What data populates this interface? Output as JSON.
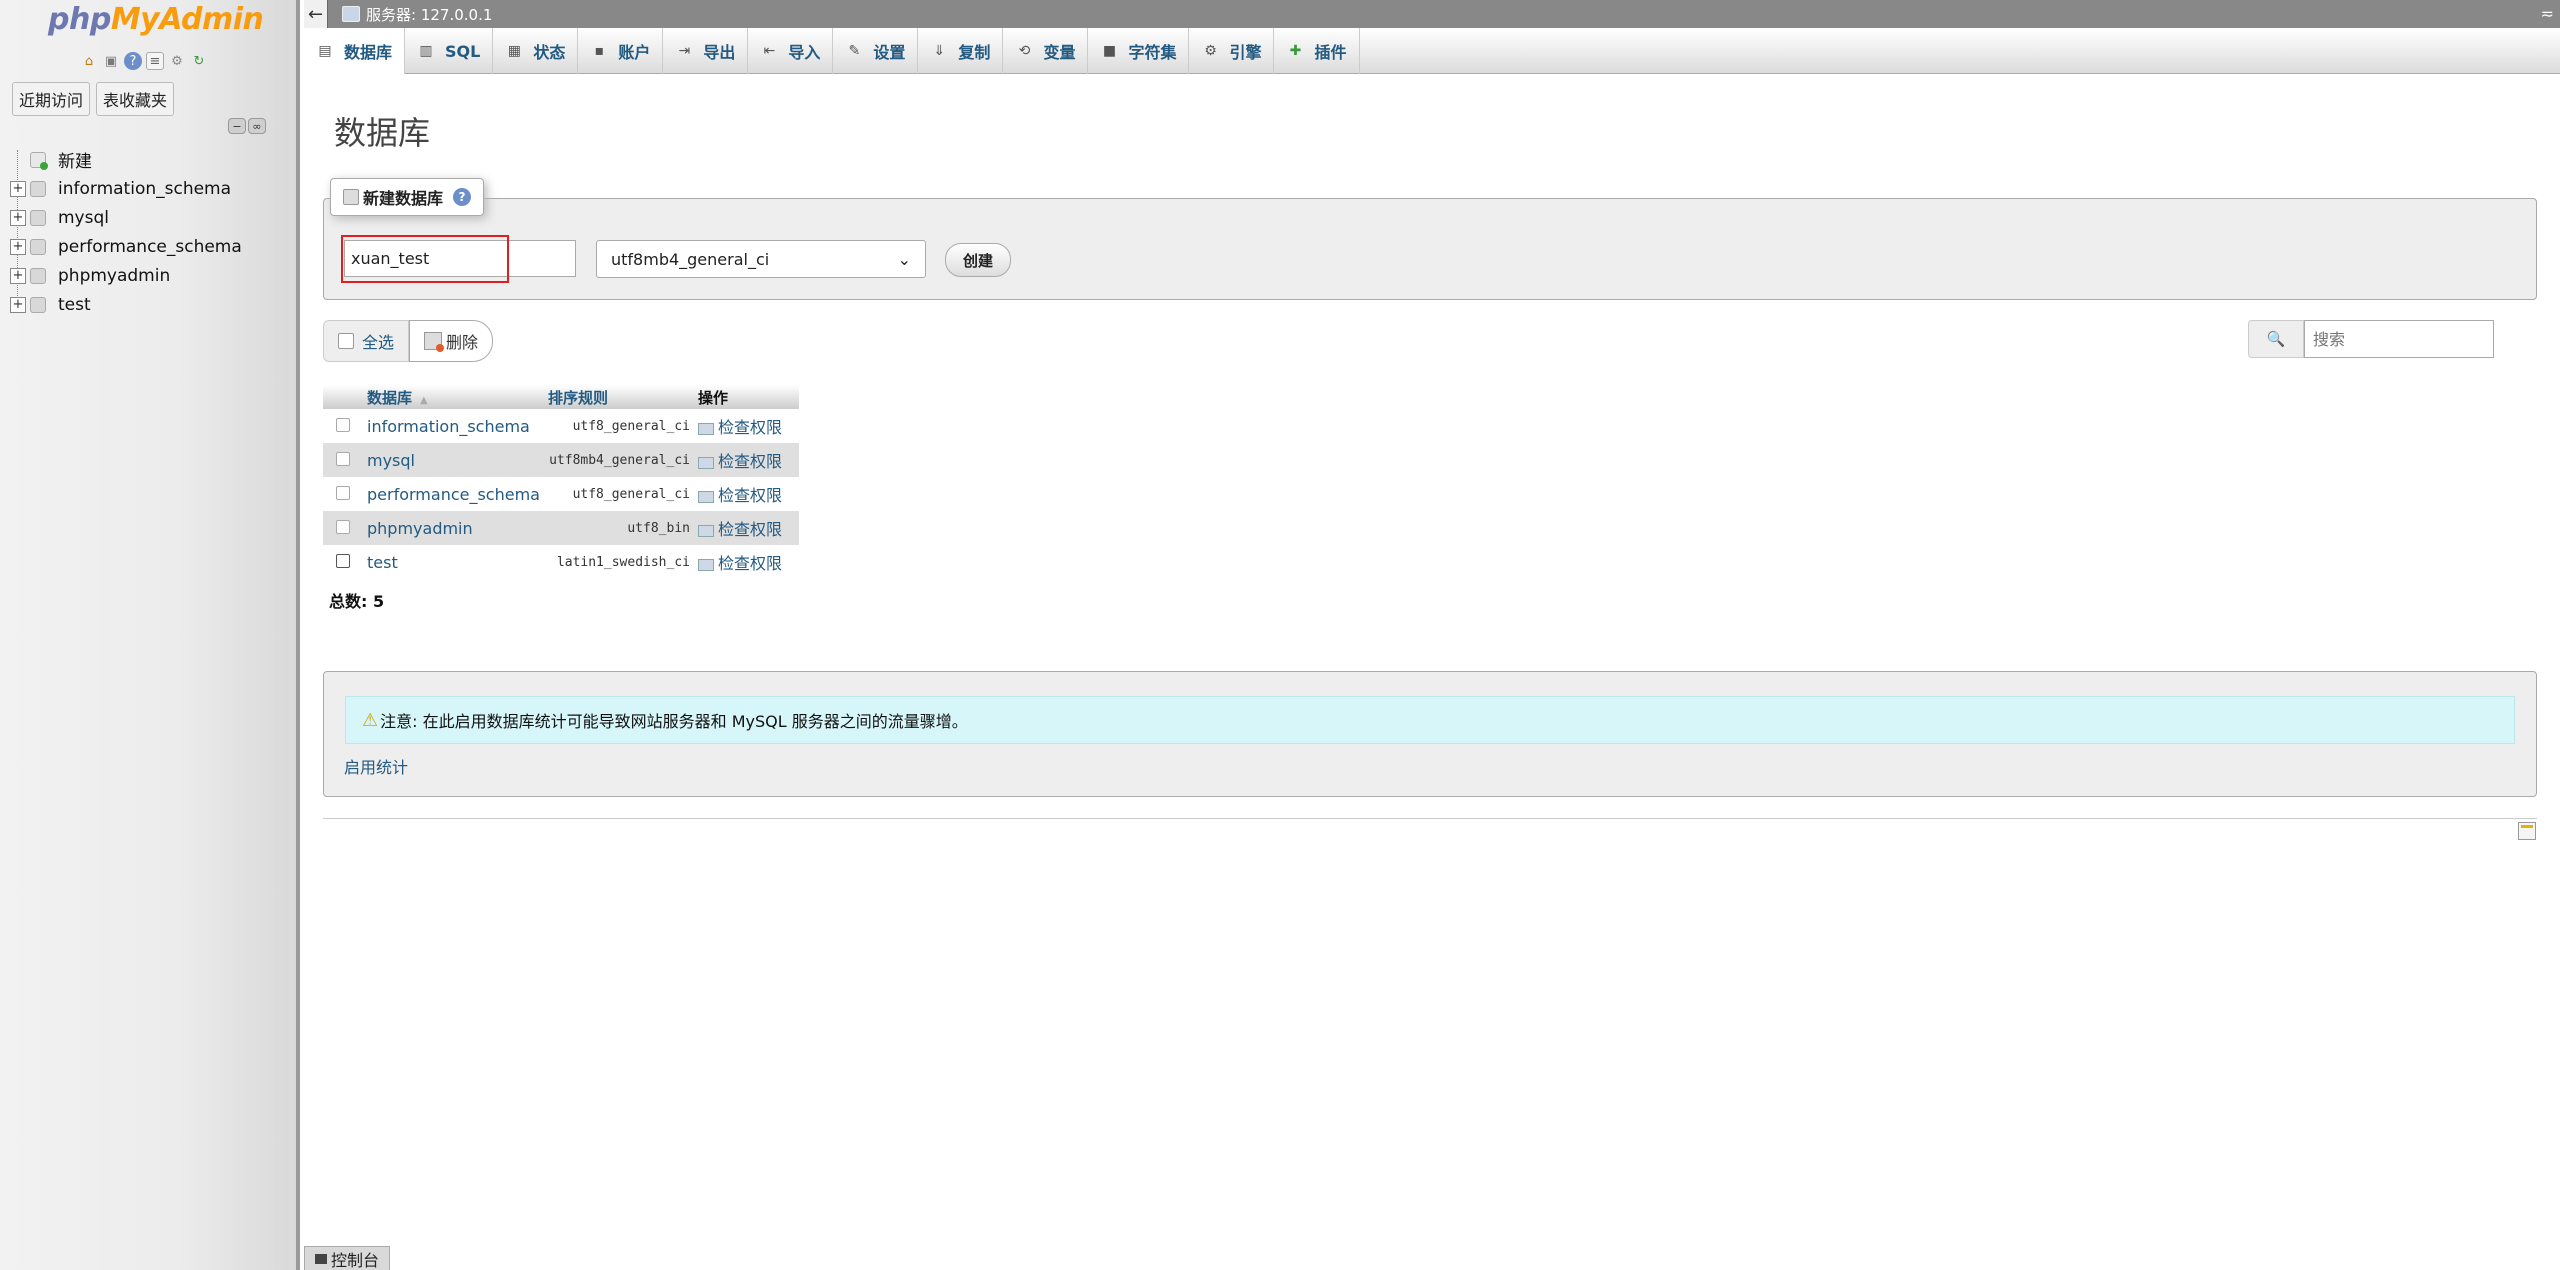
{
  "sidebar": {
    "logo": {
      "php": "php",
      "my": "My",
      "admin": "Admin"
    },
    "tabs": [
      "近期访问",
      "表收藏夹"
    ],
    "tree": [
      {
        "label": "新建",
        "expandable": false,
        "new": true
      },
      {
        "label": "information_schema",
        "expandable": true
      },
      {
        "label": "mysql",
        "expandable": true
      },
      {
        "label": "performance_schema",
        "expandable": true
      },
      {
        "label": "phpmyadmin",
        "expandable": true
      },
      {
        "label": "test",
        "expandable": true
      }
    ]
  },
  "topbar": {
    "back_glyph": "←",
    "server": "服务器:  127.0.0.1",
    "collapse_glyph": "≂"
  },
  "menu": [
    {
      "label": "数据库",
      "icon": "database-icon",
      "glyph": "▤",
      "active": true
    },
    {
      "label": "SQL",
      "icon": "sql-icon",
      "glyph": "▥"
    },
    {
      "label": "状态",
      "icon": "status-icon",
      "glyph": "▦"
    },
    {
      "label": "账户",
      "icon": "accounts-icon",
      "glyph": "▪"
    },
    {
      "label": "导出",
      "icon": "export-icon",
      "glyph": "⇥"
    },
    {
      "label": "导入",
      "icon": "import-icon",
      "glyph": "⇤"
    },
    {
      "label": "设置",
      "icon": "wrench-icon",
      "glyph": "✎"
    },
    {
      "label": "复制",
      "icon": "replication-icon",
      "glyph": "⇓"
    },
    {
      "label": "变量",
      "icon": "variables-icon",
      "glyph": "⟲"
    },
    {
      "label": "字符集",
      "icon": "charset-icon",
      "glyph": "■"
    },
    {
      "label": "引擎",
      "icon": "engine-icon",
      "glyph": "⚙"
    },
    {
      "label": "插件",
      "icon": "plugin-icon",
      "glyph": "✚"
    }
  ],
  "main": {
    "title": "数据库",
    "create": {
      "legend": "新建数据库",
      "dbname_value": "xuan_test",
      "collation": "utf8mb4_general_ci",
      "create_label": "创建"
    },
    "bulk": {
      "select_all": "全选",
      "delete": "删除"
    },
    "search": {
      "placeholder": "搜索"
    },
    "table": {
      "headers": [
        "数据库",
        "排序规则",
        "操作"
      ],
      "rows": [
        {
          "name": "information_schema",
          "collation": "utf8_general_ci",
          "action": "检查权限"
        },
        {
          "name": "mysql",
          "collation": "utf8mb4_general_ci",
          "action": "检查权限"
        },
        {
          "name": "performance_schema",
          "collation": "utf8_general_ci",
          "action": "检查权限"
        },
        {
          "name": "phpmyadmin",
          "collation": "utf8_bin",
          "action": "检查权限"
        },
        {
          "name": "test",
          "collation": "latin1_swedish_ci",
          "action": "检查权限"
        }
      ],
      "total_label": "总数:",
      "total_value": "5"
    },
    "notice": "注意: 在此启用数据库统计可能导致网站服务器和 MySQL 服务器之间的流量骤增。",
    "enable_stats": "启用统计"
  },
  "console": {
    "label": "控制台"
  },
  "colors": {
    "link": "#235a81",
    "highlight": "#e02020",
    "notice_bg": "#d7f6f9"
  }
}
